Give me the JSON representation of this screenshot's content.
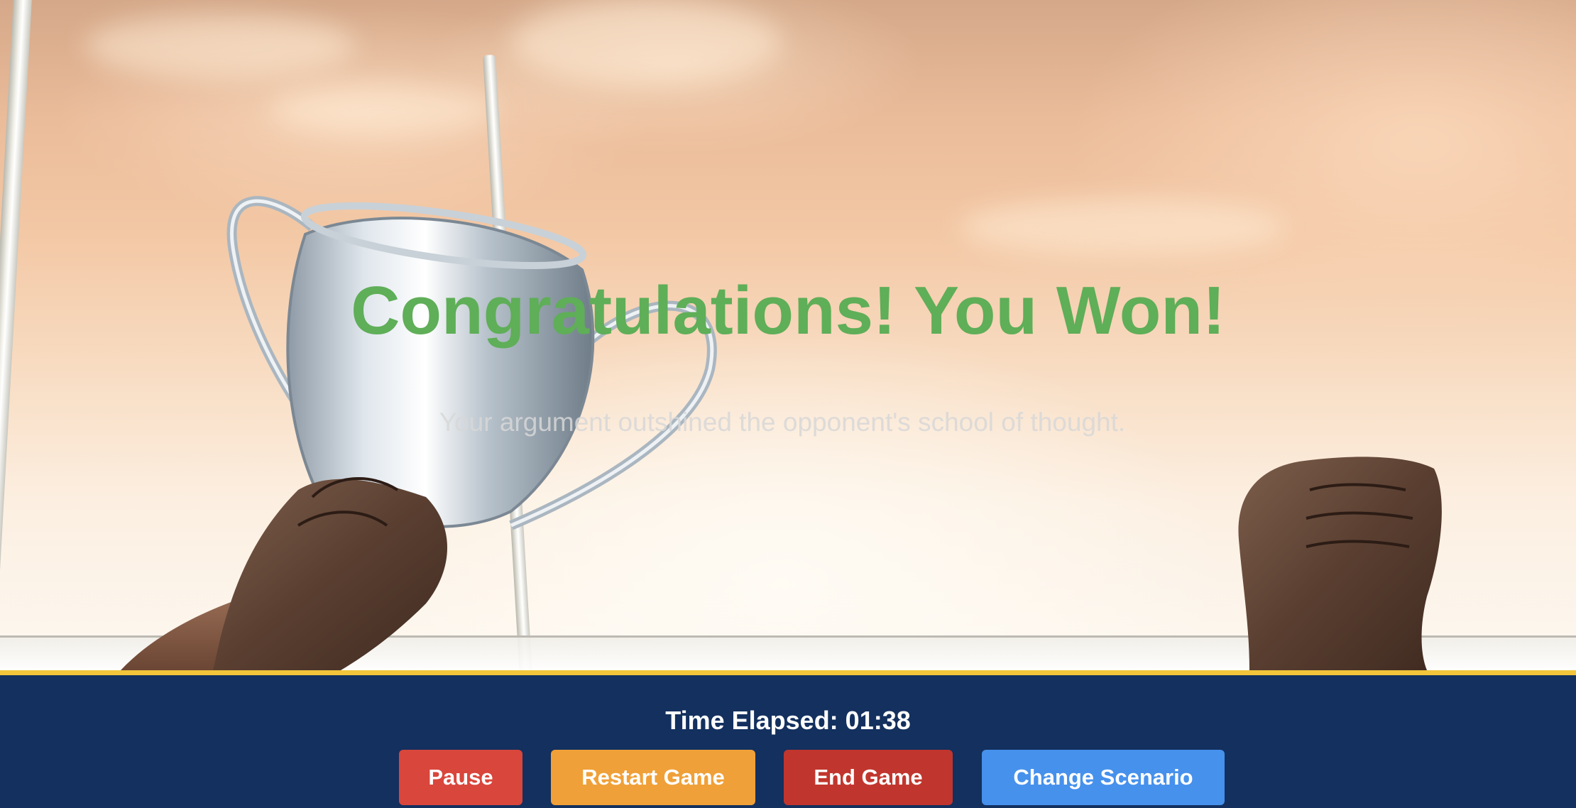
{
  "result": {
    "headline": "Congratulations! You Won!",
    "message": "Your argument outshined the opponent's school of thought."
  },
  "controls": {
    "time_elapsed_label": "Time Elapsed: 01:38",
    "pause_label": "Pause",
    "restart_label": "Restart Game",
    "end_label": "End Game",
    "change_scenario_label": "Change Scenario"
  },
  "colors": {
    "headline": "#5fae58",
    "bar_background": "#13305e",
    "bar_accent": "#f2c53a",
    "pause": "#d9463c",
    "restart": "#f0a038",
    "end": "#c0362e",
    "change_scenario": "#4691ec"
  },
  "background_image": "victory-trophy-stadium"
}
